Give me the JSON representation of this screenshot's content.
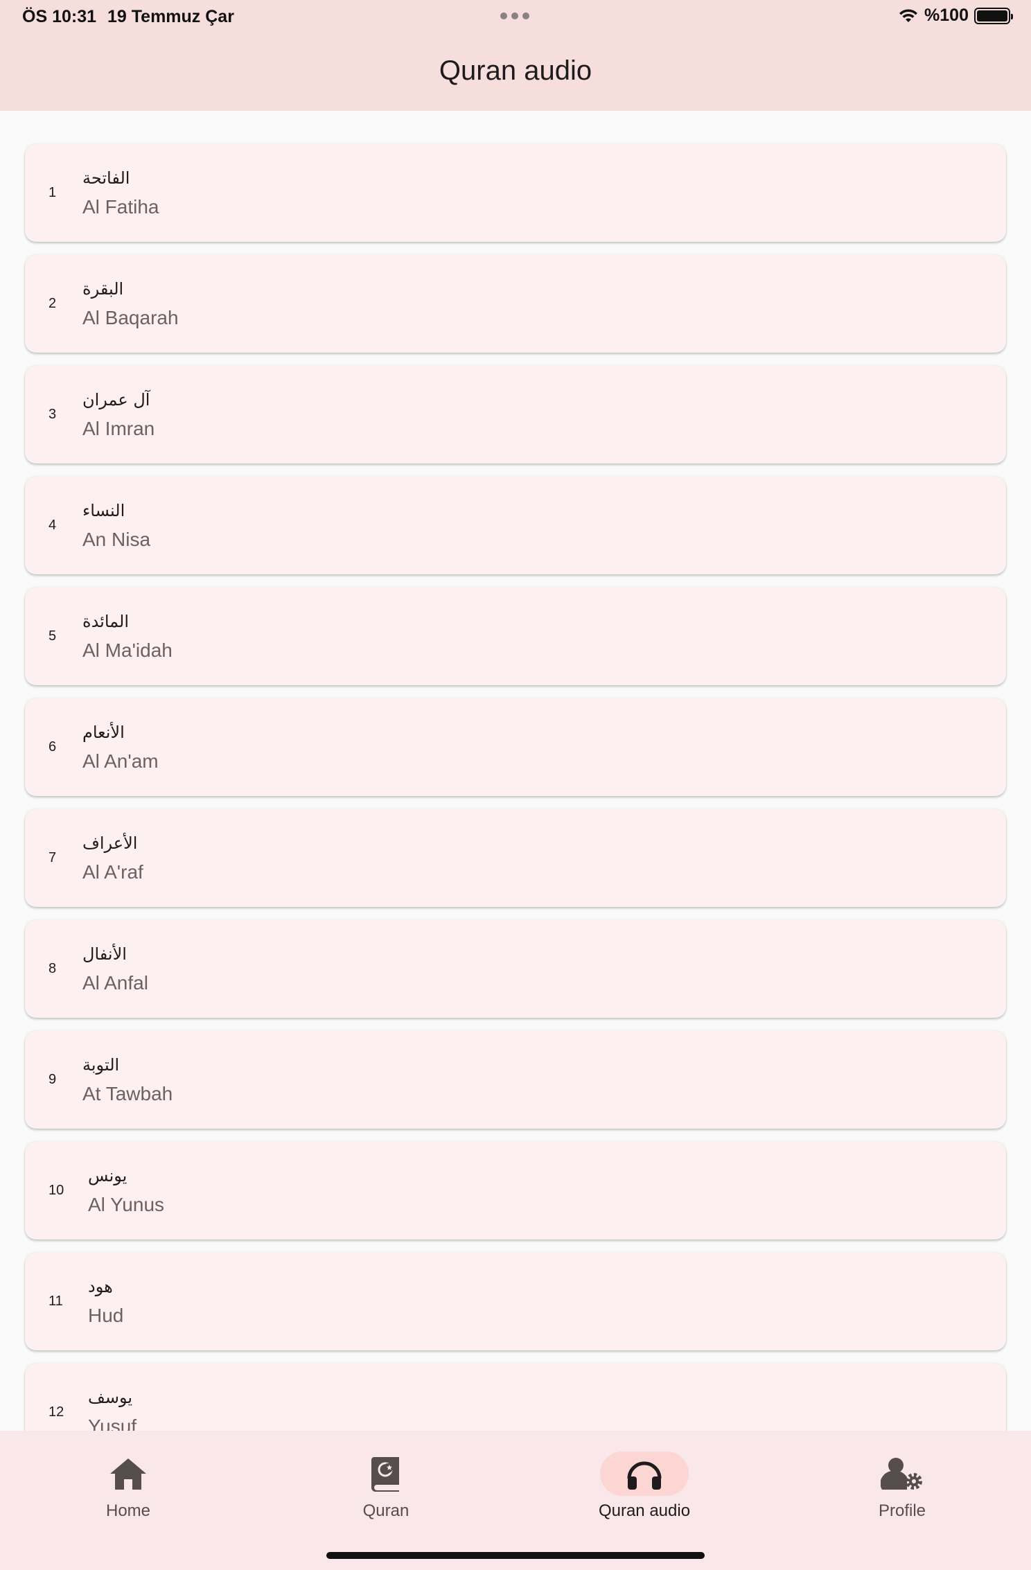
{
  "status_bar": {
    "time": "ÖS 10:31",
    "date": "19 Temmuz Çar",
    "battery": "%100"
  },
  "header": {
    "title": "Quran audio"
  },
  "surahs": [
    {
      "number": "1",
      "arabic": "الفاتحة",
      "name": "Al Fatiha"
    },
    {
      "number": "2",
      "arabic": "البقرة",
      "name": "Al Baqarah"
    },
    {
      "number": "3",
      "arabic": "آل عمران",
      "name": "Al Imran"
    },
    {
      "number": "4",
      "arabic": "النساء",
      "name": "An Nisa"
    },
    {
      "number": "5",
      "arabic": "المائدة",
      "name": "Al Ma'idah"
    },
    {
      "number": "6",
      "arabic": "الأنعام",
      "name": "Al An'am"
    },
    {
      "number": "7",
      "arabic": "الأعراف",
      "name": "Al A'raf"
    },
    {
      "number": "8",
      "arabic": "الأنفال",
      "name": "Al Anfal"
    },
    {
      "number": "9",
      "arabic": "التوبة",
      "name": "At Tawbah"
    },
    {
      "number": "10",
      "arabic": "يونس",
      "name": "Al Yunus"
    },
    {
      "number": "11",
      "arabic": "هود",
      "name": "Hud"
    },
    {
      "number": "12",
      "arabic": "يوسف",
      "name": "Yusuf"
    }
  ],
  "nav": {
    "items": [
      {
        "label": "Home",
        "icon": "home-icon"
      },
      {
        "label": "Quran",
        "icon": "book-icon"
      },
      {
        "label": "Quran audio",
        "icon": "headphones-icon"
      },
      {
        "label": "Profile",
        "icon": "user-settings-icon"
      }
    ],
    "active": "Quran audio"
  },
  "colors": {
    "header_bg": "#f5dedb",
    "card_bg": "#fcf0f1",
    "nav_bg": "#f9e7e9",
    "active_pill": "#fcd6d2"
  }
}
